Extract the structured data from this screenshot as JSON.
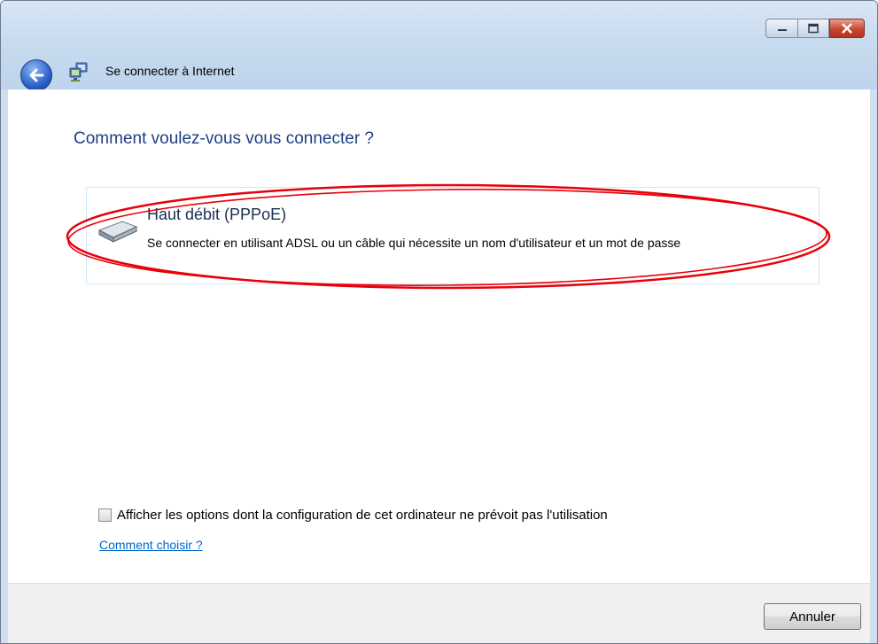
{
  "window": {
    "title": "Se connecter à Internet",
    "controls": {
      "minimize_icon": "minimize-icon",
      "maximize_icon": "maximize-icon",
      "close_icon": "close-icon"
    }
  },
  "wizard": {
    "heading": "Comment voulez-vous vous connecter ?",
    "options": [
      {
        "title": "Haut débit (PPPoE)",
        "description": "Se connecter en utilisant ADSL ou un câble qui nécessite un nom d'utilisateur et un mot de passe",
        "icon": "modem-icon",
        "highlighted": true
      }
    ],
    "show_options_checkbox": {
      "label": "Afficher les options dont la configuration de cet ordinateur ne prévoit pas l'utilisation",
      "checked": false
    },
    "help_link": "Comment choisir ?"
  },
  "footer": {
    "cancel_label": "Annuler"
  },
  "colors": {
    "heading": "#1e3e82",
    "link": "#0066cc",
    "annotation_ellipse": "#e8000a"
  }
}
